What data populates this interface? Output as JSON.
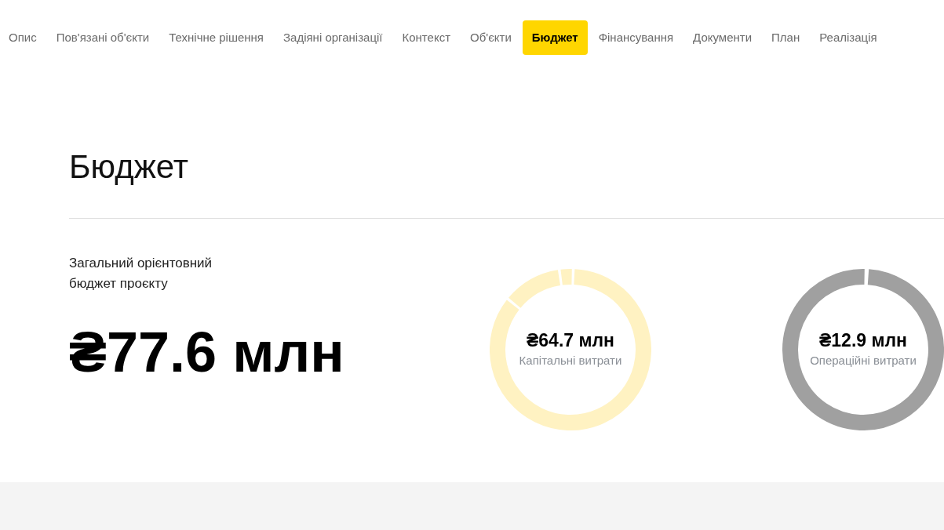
{
  "nav": [
    {
      "label": "Опис",
      "selected": false
    },
    {
      "label": "Пов'язані об'єкти",
      "selected": false
    },
    {
      "label": "Технічне рішення",
      "selected": false
    },
    {
      "label": "Задіяні організації",
      "selected": false
    },
    {
      "label": "Контекст",
      "selected": false
    },
    {
      "label": "Об'єкти",
      "selected": false
    },
    {
      "label": "Бюджет",
      "selected": true
    },
    {
      "label": "Фінансування",
      "selected": false
    },
    {
      "label": "Документи",
      "selected": false
    },
    {
      "label": "План",
      "selected": false
    },
    {
      "label": "Реалізація",
      "selected": false
    }
  ],
  "section": {
    "title": "Бюджет",
    "total_label": "Загальний орієнтовний бюджет проєкту",
    "total_value": "₴77.6 млн"
  },
  "breakdown": [
    {
      "amount": "₴64.7 млн",
      "label": "Капітальні витрати",
      "color": "#fff2c2"
    },
    {
      "amount": "₴12.9 млн",
      "label": "Операційні витрати",
      "color": "#a0a0a0"
    }
  ]
}
